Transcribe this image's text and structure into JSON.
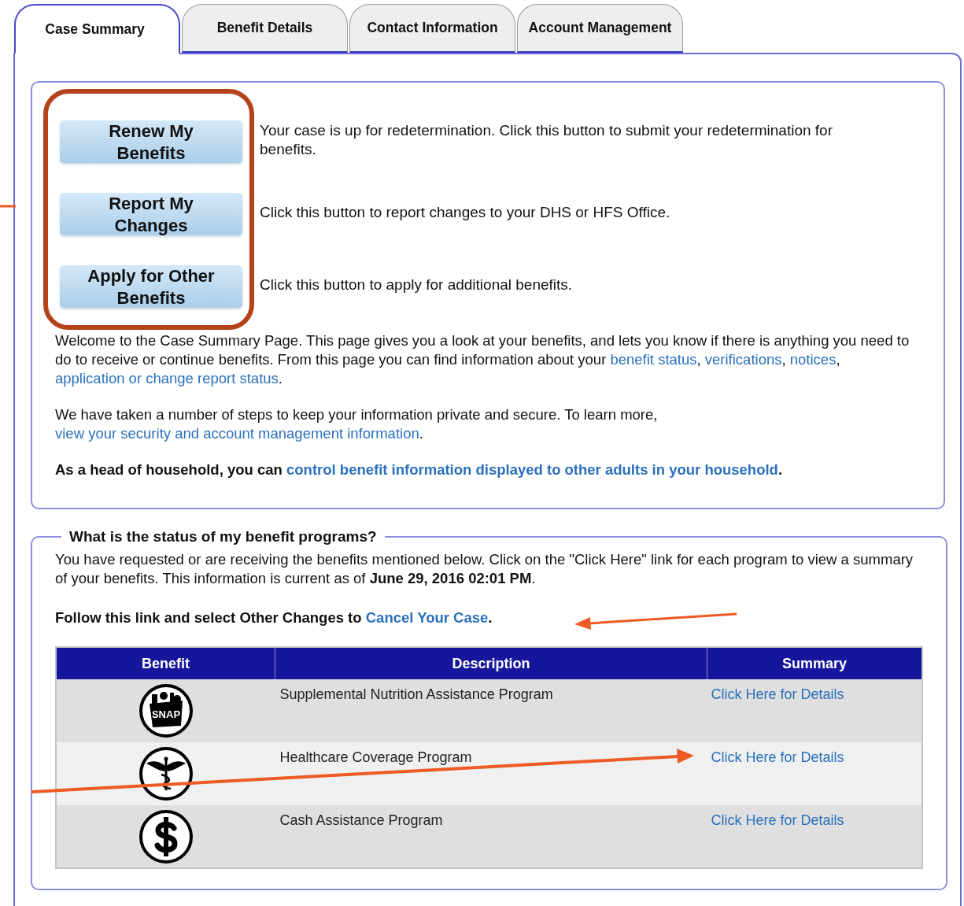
{
  "tabs": [
    {
      "label": "Case Summary",
      "selected": true
    },
    {
      "label": "Benefit Details",
      "selected": false
    },
    {
      "label": "Contact Information",
      "selected": false
    },
    {
      "label": "Account Management",
      "selected": false
    }
  ],
  "actions": [
    {
      "button": "Renew My Benefits",
      "description": "Your case is up for redetermination. Click this button to submit your redetermination for benefits."
    },
    {
      "button": "Report My Changes",
      "description": "Click this button to report changes to your DHS or HFS Office."
    },
    {
      "button": "Apply for Other Benefits",
      "description": "Click this button to apply for additional benefits."
    }
  ],
  "intro_paragraphs": [
    {
      "bold": false,
      "segments": [
        {
          "text": "Welcome to the Case Summary Page. This page gives you a look at your benefits, and lets you know if there is anything you need to do to receive or continue benefits. From this page you can find information about your "
        },
        {
          "text": "benefit status",
          "link": true
        },
        {
          "text": ", "
        },
        {
          "text": "verifications",
          "link": true
        },
        {
          "text": ", "
        },
        {
          "text": "notices",
          "link": true
        },
        {
          "text": ", "
        },
        {
          "text": "application or change report status",
          "link": true
        },
        {
          "text": "."
        }
      ]
    },
    {
      "bold": false,
      "segments": [
        {
          "text": "We have taken a number of steps to keep your information private and secure. To learn more, "
        },
        {
          "text": "view your security and account management information",
          "link": true
        },
        {
          "text": "."
        }
      ]
    },
    {
      "bold": true,
      "segments": [
        {
          "text": "As a head of household, you can "
        },
        {
          "text": "control benefit information displayed to other adults in your household",
          "link": true
        },
        {
          "text": "."
        }
      ]
    }
  ],
  "status_section": {
    "legend": "What is the status of my benefit programs?",
    "paragraphs": [
      {
        "bold": false,
        "segments": [
          {
            "text": "You have requested or are receiving the benefits mentioned below. Click on the \"Click Here\" link for each program to view a summary of your benefits. This information is current as of **June 29, 2016 02:01 PM**."
          }
        ]
      },
      {
        "bold": true,
        "segments": [
          {
            "text": "Follow this link and select Other Changes to "
          },
          {
            "text": "Cancel Your Case",
            "link": true
          },
          {
            "text": "."
          }
        ]
      }
    ],
    "table": {
      "columns": [
        "Benefit",
        "Description",
        "Summary"
      ],
      "rows": [
        {
          "kind": "snap",
          "icon_text": "SNAP",
          "description": "Supplemental Nutrition Assistance Program",
          "summary": "Click Here for Details"
        },
        {
          "kind": "medical",
          "description": "Healthcare Coverage Program",
          "summary": "Click Here for Details"
        },
        {
          "kind": "cash",
          "description": "Cash Assistance Program",
          "summary": "Click Here for Details"
        }
      ]
    }
  }
}
